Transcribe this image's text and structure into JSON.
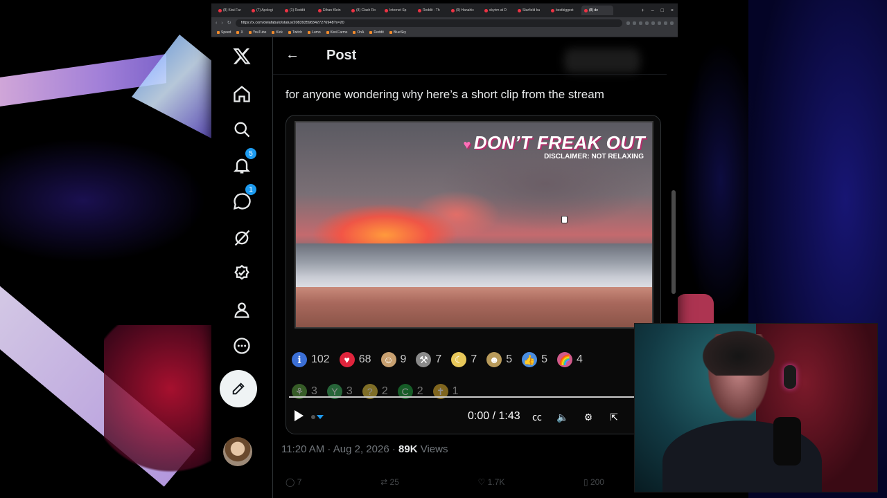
{
  "browser": {
    "tabs": [
      {
        "label": "(8) Kiwi Far"
      },
      {
        "label": "(7) Apologi"
      },
      {
        "label": "(1) Reddit"
      },
      {
        "label": "Ethan Klein"
      },
      {
        "label": "(8) Clash Ro"
      },
      {
        "label": "Internet Sp"
      },
      {
        "label": "Reddit - Th"
      },
      {
        "label": "(9) Hanahic"
      },
      {
        "label": "skyrim at D"
      },
      {
        "label": "Starfield bu"
      },
      {
        "label": "bestbiggest"
      },
      {
        "label": "(8) de"
      }
    ],
    "url": "https://x.com/delafabulo/status/2083935983427276948?s=20",
    "bookmarks": [
      "Speed",
      "X",
      "YouTube",
      "Kick",
      "Twitch",
      "Lumo",
      "Kiwi Farms",
      "OnA",
      "Reddit",
      "BlueSky"
    ]
  },
  "sidebar": {
    "logo": "X",
    "notifications_badge": "5",
    "messages_badge": "1",
    "items": [
      "home-icon",
      "search-icon",
      "notifications-icon",
      "messages-icon",
      "grok-icon",
      "verified-icon",
      "profile-icon",
      "more-icon"
    ],
    "compose_icon": "compose-icon"
  },
  "header": {
    "title": "Post"
  },
  "tweet": {
    "text": "for anyone wondering why here’s a short clip from the stream",
    "video": {
      "overlay_heart": "♥",
      "overlay_title": "DON’T FREAK OUT",
      "overlay_subtitle": "DISCLAIMER: NOT RELAXING",
      "time": "0:00 / 1:43"
    },
    "reactions_row1": [
      {
        "emoji": "ℹ",
        "color": "#3b6fd6",
        "count": "102"
      },
      {
        "emoji": "♥",
        "color": "#e0243c",
        "count": "68"
      },
      {
        "emoji": "☺",
        "color": "#c8a070",
        "count": "9"
      },
      {
        "emoji": "⚒",
        "color": "#8a8a8a",
        "count": "7"
      },
      {
        "emoji": "☾",
        "color": "#e8c85a",
        "count": "7"
      },
      {
        "emoji": "☻",
        "color": "#b89a5a",
        "count": "5"
      },
      {
        "emoji": "👍",
        "color": "#4a8de0",
        "count": "5"
      },
      {
        "emoji": "🌈",
        "color": "#d05a8a",
        "count": "4"
      }
    ],
    "reactions_row2": [
      {
        "emoji": "⚘",
        "color": "#5aa040",
        "count": "3"
      },
      {
        "emoji": "Y",
        "color": "#40b060",
        "count": "3"
      },
      {
        "emoji": "?",
        "color": "#e0c040",
        "count": "2"
      },
      {
        "emoji": "C",
        "color": "#20a040",
        "count": "2"
      },
      {
        "emoji": "✝",
        "color": "#e0b030",
        "count": "1"
      }
    ],
    "timestamp": "11:20 AM · Aug 2, 2026 ·",
    "views_count": "89K",
    "views_label": "Views",
    "actions": [
      {
        "icon": "reply-icon",
        "count": "7"
      },
      {
        "icon": "repost-icon",
        "count": "25"
      },
      {
        "icon": "like-icon",
        "count": "1.7K"
      },
      {
        "icon": "bookmark-icon",
        "count": "200"
      }
    ]
  },
  "colors": {
    "accent": "#1d9bf0",
    "background": "#000000",
    "text": "#e7e9ea",
    "muted": "#71767b"
  }
}
